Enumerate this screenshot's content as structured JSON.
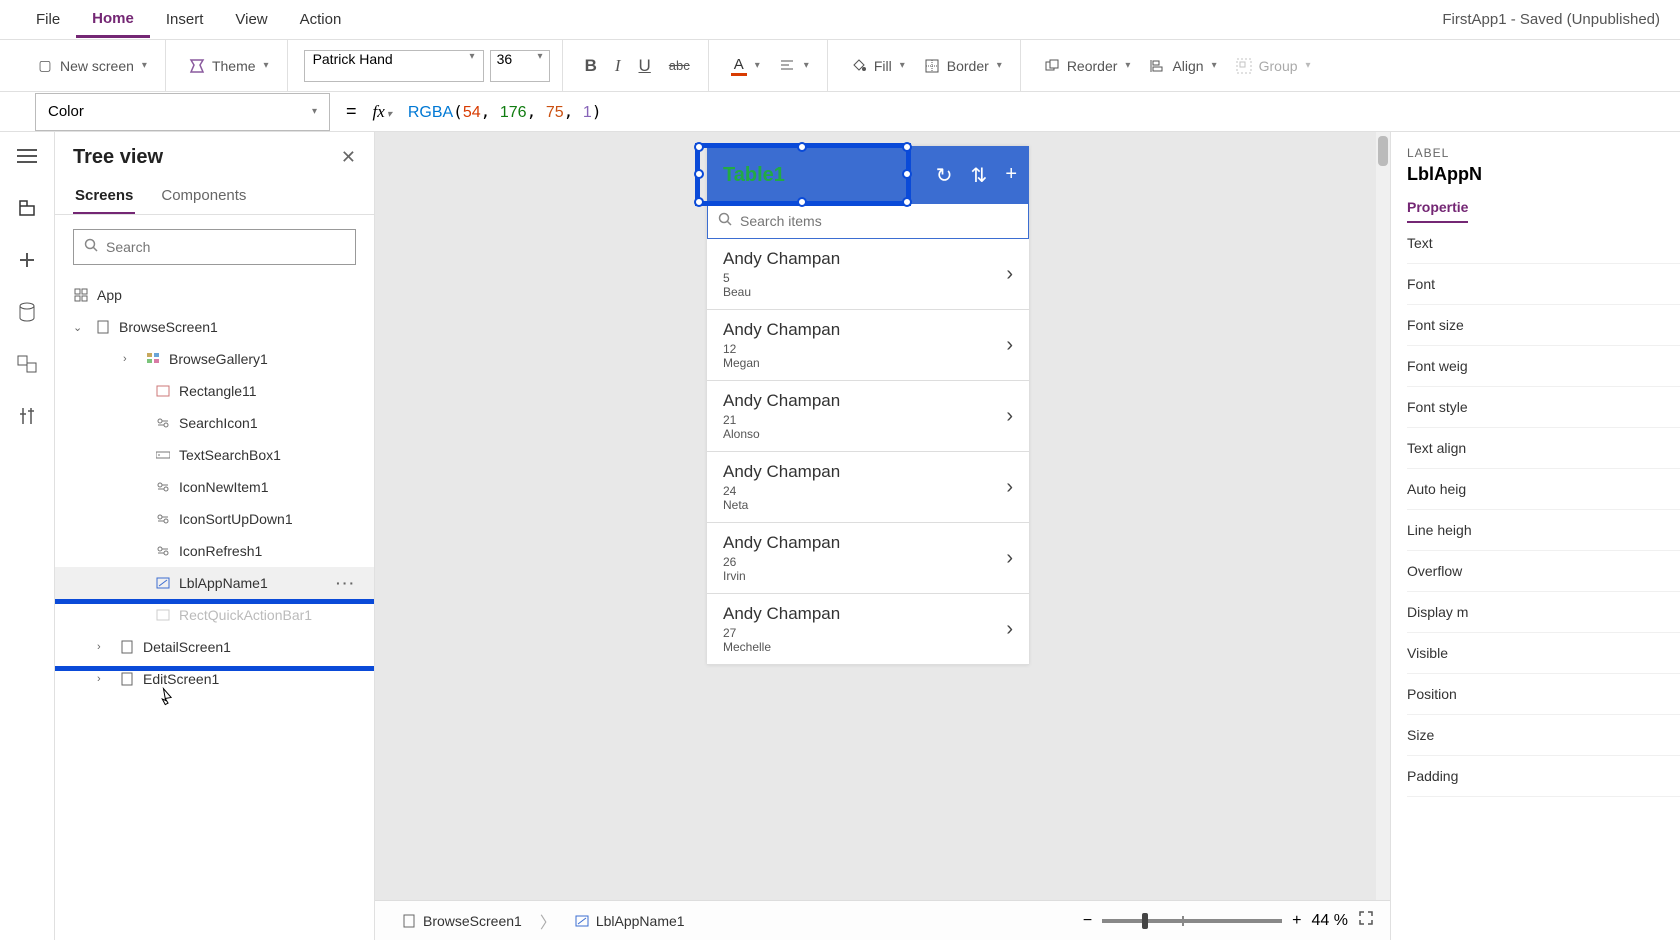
{
  "menubar": {
    "items": [
      "File",
      "Home",
      "Insert",
      "View",
      "Action"
    ],
    "active": "Home",
    "app_title": "FirstApp1 - Saved (Unpublished)"
  },
  "ribbon": {
    "new_screen": "New screen",
    "theme": "Theme",
    "font_name": "Patrick Hand",
    "font_size": "36",
    "fill": "Fill",
    "border": "Border",
    "reorder": "Reorder",
    "align": "Align",
    "group": "Group"
  },
  "formula": {
    "property": "Color",
    "value_fn": "RGBA",
    "value_args": [
      "54",
      "176",
      "75",
      "1"
    ]
  },
  "tree": {
    "title": "Tree view",
    "tabs": [
      "Screens",
      "Components"
    ],
    "search_placeholder": "Search",
    "items": {
      "app": "App",
      "browse_screen": "BrowseScreen1",
      "gallery": "BrowseGallery1",
      "rect": "Rectangle11",
      "search_icon": "SearchIcon1",
      "text_search": "TextSearchBox1",
      "icon_new": "IconNewItem1",
      "icon_sort": "IconSortUpDown1",
      "icon_refresh": "IconRefresh1",
      "lbl_app": "LblAppName1",
      "rect_bar": "RectQuickActionBar1",
      "detail": "DetailScreen1",
      "edit": "EditScreen1"
    }
  },
  "preview": {
    "header_title": "Table1",
    "search_placeholder": "Search items",
    "rows": [
      {
        "name": "Andy Champan",
        "num": "5",
        "sub": "Beau"
      },
      {
        "name": "Andy Champan",
        "num": "12",
        "sub": "Megan"
      },
      {
        "name": "Andy Champan",
        "num": "21",
        "sub": "Alonso"
      },
      {
        "name": "Andy Champan",
        "num": "24",
        "sub": "Neta"
      },
      {
        "name": "Andy Champan",
        "num": "26",
        "sub": "Irvin"
      },
      {
        "name": "Andy Champan",
        "num": "27",
        "sub": "Mechelle"
      }
    ]
  },
  "breadcrumb": {
    "screen": "BrowseScreen1",
    "control": "LblAppName1"
  },
  "zoom": {
    "value": "44",
    "unit": "%"
  },
  "properties": {
    "type": "LABEL",
    "name": "LblAppN",
    "tab": "Propertie",
    "rows": [
      "Text",
      "Font",
      "Font size",
      "Font weig",
      "Font style",
      "Text align",
      "Auto heig",
      "Line heigh",
      "Overflow",
      "Display m",
      "Visible",
      "Position",
      "Size",
      "Padding"
    ]
  }
}
